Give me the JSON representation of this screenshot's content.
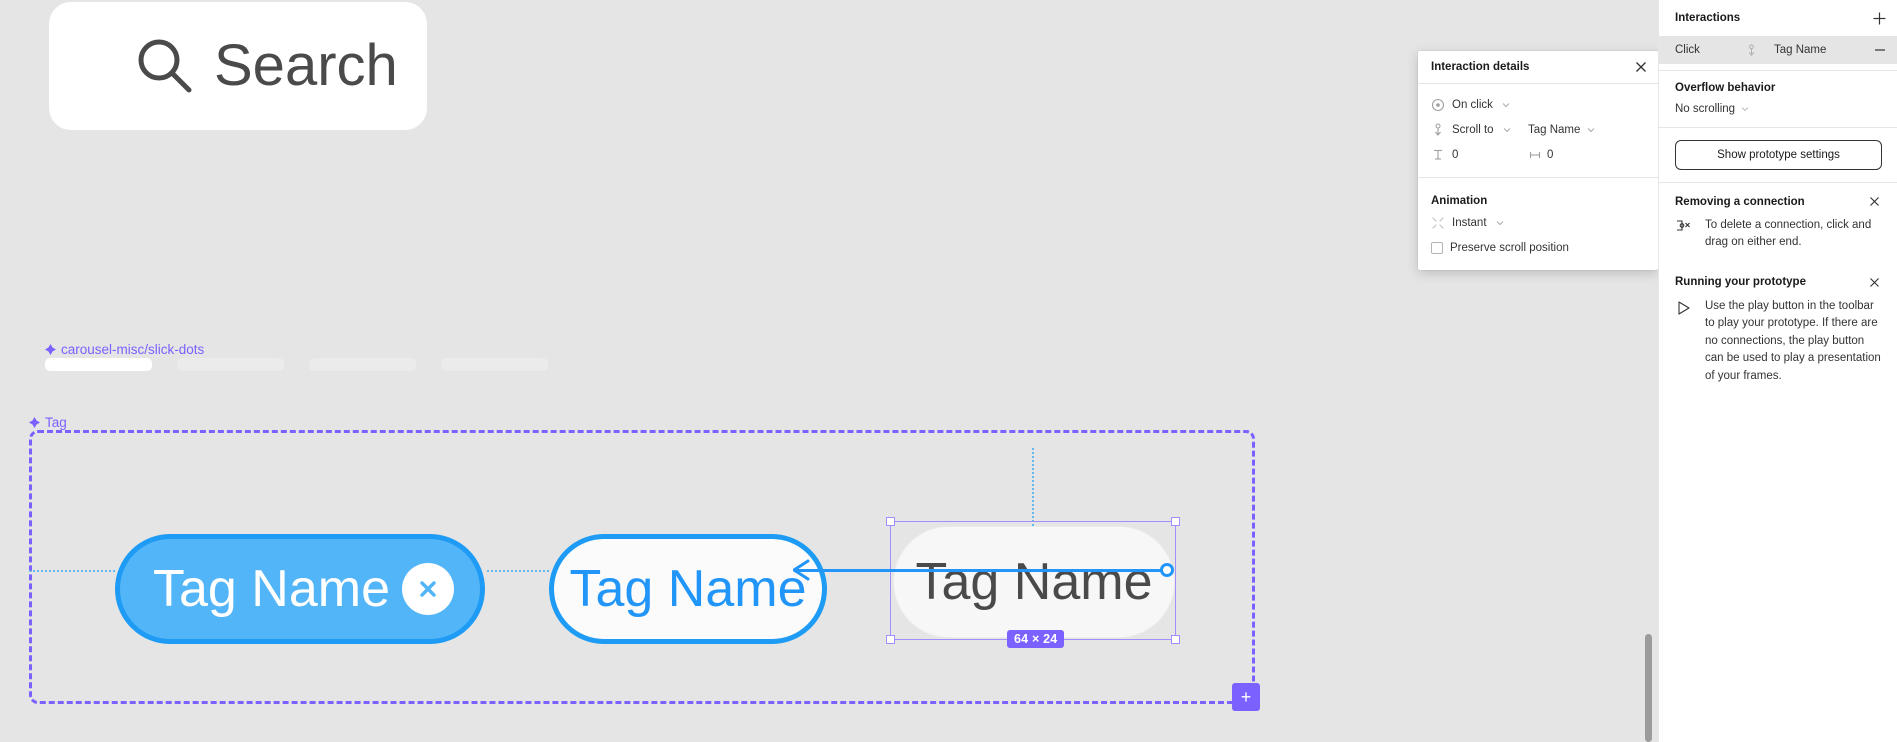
{
  "canvas": {
    "search_component": {
      "label": "Search",
      "icon": "search-icon"
    },
    "carousel": {
      "component_label": "carousel-misc/slick-dots",
      "dots": [
        "",
        "",
        "",
        ""
      ]
    },
    "tag_frame": {
      "component_label": "Tag",
      "add_label": "+",
      "tags": [
        {
          "label": "Tag Name",
          "style": "filled",
          "close_icon": "close-icon"
        },
        {
          "label": "Tag Name",
          "style": "outline"
        },
        {
          "label": "Tag Name",
          "style": "plain"
        }
      ]
    },
    "selection": {
      "size_badge": "64 × 24"
    },
    "colors": {
      "background": "#e5e5e5",
      "accent_blue": "#2196f8",
      "tag_fill": "#52b5f7",
      "component_purple": "#7b61ff"
    }
  },
  "interaction_details": {
    "title": "Interaction details",
    "close_icon": "close-icon",
    "trigger": {
      "icon": "click-target-icon",
      "value": "On click",
      "caret": "chevron-down-icon"
    },
    "action": {
      "icon": "scroll-to-icon",
      "value": "Scroll to",
      "target_value": "Tag Name",
      "caret": "chevron-down-icon"
    },
    "offsets": {
      "vertical_icon": "vertical-offset-icon",
      "vertical_value": "0",
      "horizontal_icon": "horizontal-offset-icon",
      "horizontal_value": "0"
    },
    "animation": {
      "heading": "Animation",
      "icon": "animation-icon",
      "value": "Instant",
      "caret": "chevron-down-icon",
      "preserve_scroll_label": "Preserve scroll position",
      "preserve_scroll_checked": false
    }
  },
  "sidebar": {
    "header": {
      "title": "Interactions",
      "add_icon": "plus-icon"
    },
    "interaction_row": {
      "trigger": "Click",
      "arrow_icon": "scroll-to-icon",
      "target": "Tag Name",
      "remove_icon": "minus-icon"
    },
    "overflow": {
      "title": "Overflow behavior",
      "value": "No scrolling",
      "caret": "chevron-down-icon"
    },
    "prototype_settings_button": "Show prototype settings",
    "tips": [
      {
        "title": "Removing a connection",
        "icon": "connection-delete-icon",
        "text": "To delete a connection, click and drag on either end.",
        "close_icon": "close-icon"
      },
      {
        "title": "Running your prototype",
        "icon": "play-icon",
        "text": "Use the play button in the toolbar to play your prototype. If there are no connections, the play button can be used to play a presentation of your frames.",
        "close_icon": "close-icon"
      }
    ]
  }
}
